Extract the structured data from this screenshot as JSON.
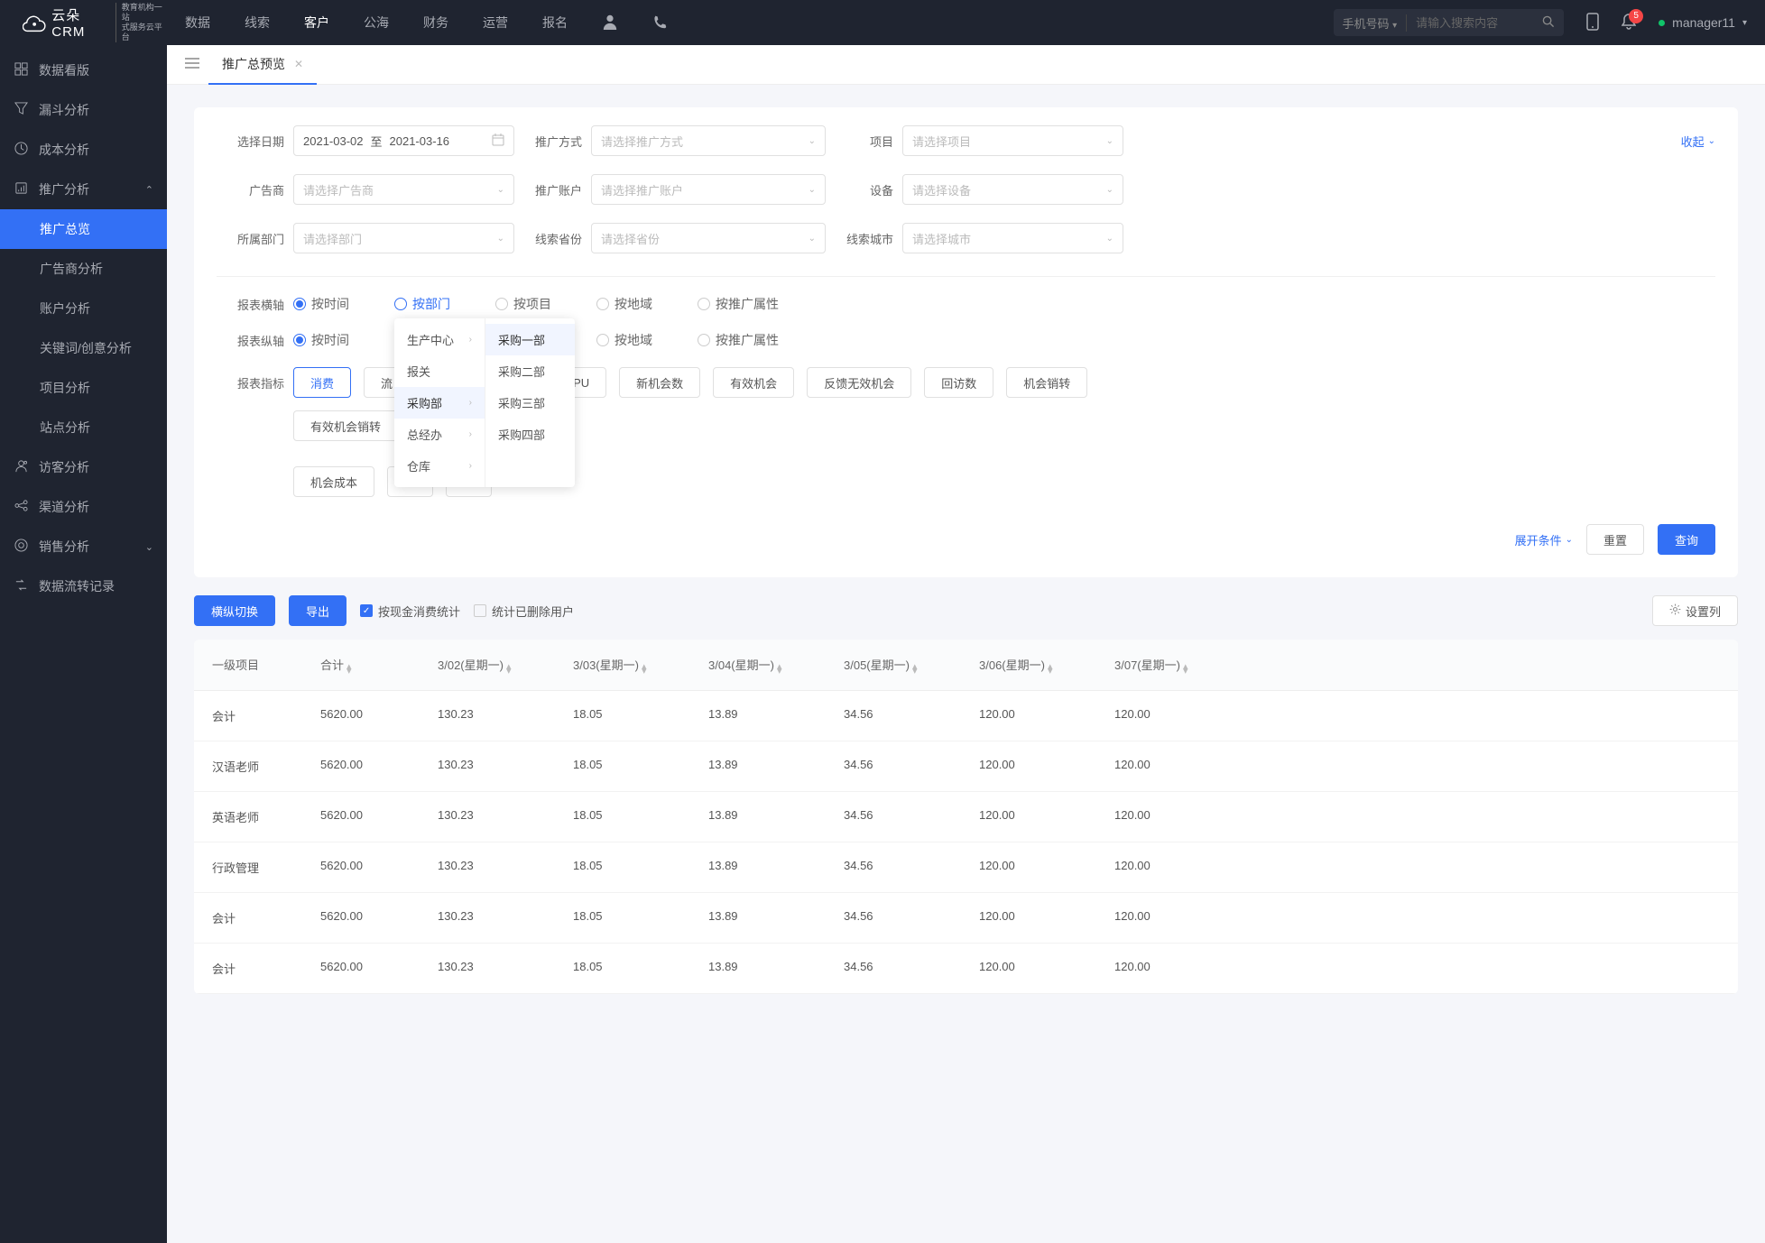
{
  "header": {
    "brand_main": "云朵CRM",
    "brand_sub1": "教育机构一站",
    "brand_sub2": "式服务云平台",
    "nav": [
      "数据",
      "线索",
      "客户",
      "公海",
      "财务",
      "运营",
      "报名"
    ],
    "nav_active": 2,
    "search_type": "手机号码",
    "search_placeholder": "请输入搜索内容",
    "badge_count": "5",
    "username": "manager11"
  },
  "sidebar": {
    "items": [
      {
        "icon": "dashboard",
        "label": "数据看版"
      },
      {
        "icon": "funnel",
        "label": "漏斗分析"
      },
      {
        "icon": "cost",
        "label": "成本分析"
      },
      {
        "icon": "promo",
        "label": "推广分析",
        "expanded": true,
        "children": [
          {
            "label": "推广总览",
            "active": true
          },
          {
            "label": "广告商分析"
          },
          {
            "label": "账户分析"
          },
          {
            "label": "关键词/创意分析"
          },
          {
            "label": "项目分析"
          },
          {
            "label": "站点分析"
          }
        ]
      },
      {
        "icon": "visitor",
        "label": "访客分析"
      },
      {
        "icon": "channel",
        "label": "渠道分析"
      },
      {
        "icon": "sales",
        "label": "销售分析",
        "collapsible": true
      },
      {
        "icon": "flow",
        "label": "数据流转记录"
      }
    ]
  },
  "tab": {
    "title": "推广总预览"
  },
  "filters": {
    "date_label": "选择日期",
    "date_from": "2021-03-02",
    "date_sep": "至",
    "date_to": "2021-03-16",
    "method_label": "推广方式",
    "method_ph": "请选择推广方式",
    "project_label": "项目",
    "project_ph": "请选择项目",
    "collapse_text": "收起",
    "advertiser_label": "广告商",
    "advertiser_ph": "请选择广告商",
    "account_label": "推广账户",
    "account_ph": "请选择推广账户",
    "device_label": "设备",
    "device_ph": "请选择设备",
    "dept_label": "所属部门",
    "dept_ph": "请选择部门",
    "province_label": "线索省份",
    "province_ph": "请选择省份",
    "city_label": "线索城市",
    "city_ph": "请选择城市"
  },
  "radio": {
    "haxis_label": "报表横轴",
    "vaxis_label": "报表纵轴",
    "options": [
      "按时间",
      "按部门",
      "按项目",
      "按地域",
      "按推广属性"
    ]
  },
  "metric": {
    "label": "报表指标",
    "tags": [
      "消费",
      "流",
      "···",
      "···",
      "ARPU",
      "新机会数",
      "有效机会",
      "反馈无效机会",
      "回访数",
      "机会销转",
      "有效机会销转",
      "机会成本",
      "···",
      "···"
    ]
  },
  "cascade": {
    "col1": [
      {
        "label": "生产中心",
        "arrow": true
      },
      {
        "label": "报关"
      },
      {
        "label": "采购部",
        "arrow": true,
        "hover": true
      },
      {
        "label": "总经办",
        "arrow": true
      },
      {
        "label": "仓库",
        "arrow": true
      }
    ],
    "col2": [
      {
        "label": "采购一部",
        "hover": true
      },
      {
        "label": "采购二部"
      },
      {
        "label": "采购三部"
      },
      {
        "label": "采购四部"
      }
    ]
  },
  "actions": {
    "expand": "展开条件",
    "reset": "重置",
    "query": "查询"
  },
  "toolbar": {
    "swap": "横纵切换",
    "export": "导出",
    "cash_stat": "按现金消费统计",
    "deleted_stat": "统计已删除用户",
    "col_setting": "设置列"
  },
  "table": {
    "columns": [
      "一级项目",
      "合计",
      "3/02(星期一)",
      "3/03(星期一)",
      "3/04(星期一)",
      "3/05(星期一)",
      "3/06(星期一)",
      "3/07(星期一)"
    ],
    "rows": [
      {
        "c0": "会计",
        "c1": "5620.00",
        "c2": "130.23",
        "c3": "18.05",
        "c4": "13.89",
        "c5": "34.56",
        "c6": "120.00",
        "c7": "120.00"
      },
      {
        "c0": "汉语老师",
        "c1": "5620.00",
        "c2": "130.23",
        "c3": "18.05",
        "c4": "13.89",
        "c5": "34.56",
        "c6": "120.00",
        "c7": "120.00"
      },
      {
        "c0": "英语老师",
        "c1": "5620.00",
        "c2": "130.23",
        "c3": "18.05",
        "c4": "13.89",
        "c5": "34.56",
        "c6": "120.00",
        "c7": "120.00"
      },
      {
        "c0": "行政管理",
        "c1": "5620.00",
        "c2": "130.23",
        "c3": "18.05",
        "c4": "13.89",
        "c5": "34.56",
        "c6": "120.00",
        "c7": "120.00"
      },
      {
        "c0": "会计",
        "c1": "5620.00",
        "c2": "130.23",
        "c3": "18.05",
        "c4": "13.89",
        "c5": "34.56",
        "c6": "120.00",
        "c7": "120.00"
      },
      {
        "c0": "会计",
        "c1": "5620.00",
        "c2": "130.23",
        "c3": "18.05",
        "c4": "13.89",
        "c5": "34.56",
        "c6": "120.00",
        "c7": "120.00"
      }
    ]
  }
}
